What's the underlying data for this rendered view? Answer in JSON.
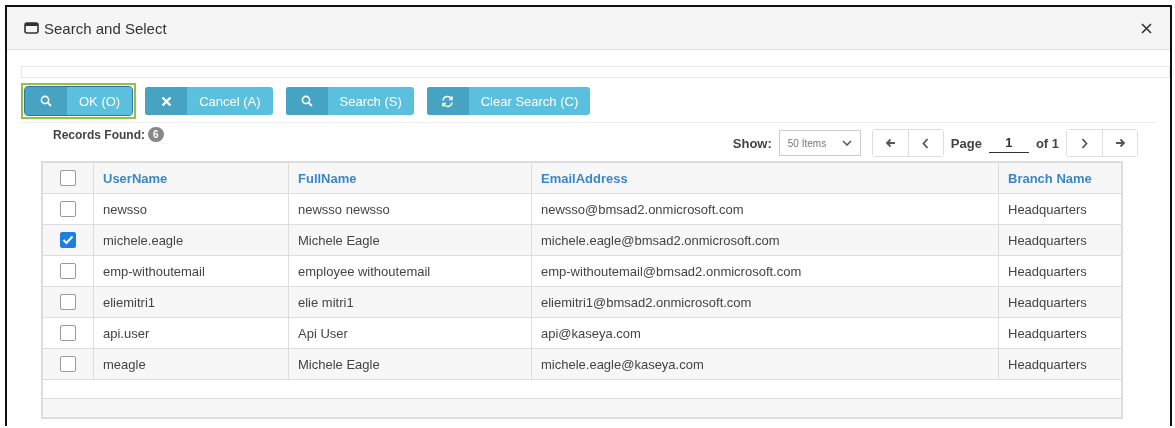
{
  "window": {
    "title": "Search and Select"
  },
  "buttons": [
    {
      "label": "OK (O)",
      "kind": "search",
      "focused": true
    },
    {
      "label": "Cancel (A)",
      "kind": "close",
      "focused": false
    },
    {
      "label": "Search (S)",
      "kind": "search",
      "focused": false
    },
    {
      "label": "Clear Search (C)",
      "kind": "refresh",
      "focused": false
    }
  ],
  "records": {
    "label": "Records Found:",
    "count": "6"
  },
  "pager": {
    "show_label": "Show:",
    "page_size": "50 Items",
    "page_label": "Page",
    "page": "1",
    "of": "of 1"
  },
  "table": {
    "all_checked": false,
    "columns": [
      "UserName",
      "FullName",
      "EmailAddress",
      "Branch Name"
    ],
    "rows": [
      {
        "checked": false,
        "cells": [
          "newsso",
          "newsso newsso",
          "newsso@bmsad2.onmicrosoft.com",
          "Headquarters"
        ]
      },
      {
        "checked": true,
        "cells": [
          "michele.eagle",
          "Michele Eagle",
          "michele.eagle@bmsad2.onmicrosoft.com",
          "Headquarters"
        ]
      },
      {
        "checked": false,
        "cells": [
          "emp-withoutemail",
          "employee withoutemail",
          "emp-withoutemail@bmsad2.onmicrosoft.com",
          "Headquarters"
        ]
      },
      {
        "checked": false,
        "cells": [
          "eliemitri1",
          "elie mitri1",
          "eliemitri1@bmsad2.onmicrosoft.com",
          "Headquarters"
        ]
      },
      {
        "checked": false,
        "cells": [
          "api.user",
          "Api User",
          "api@kaseya.com",
          "Headquarters"
        ]
      },
      {
        "checked": false,
        "cells": [
          "meagle",
          "Michele Eagle",
          "michele.eagle@kaseya.com",
          "Headquarters"
        ]
      }
    ]
  }
}
